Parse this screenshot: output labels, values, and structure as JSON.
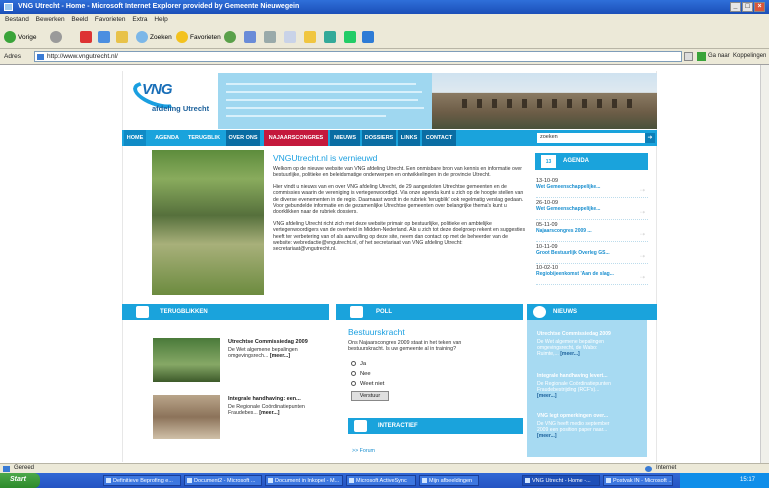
{
  "window": {
    "title": "VNG Utrecht - Home - Microsoft Internet Explorer provided by Gemeente Nieuwegein"
  },
  "menu": [
    "Bestand",
    "Bewerken",
    "Beeld",
    "Favorieten",
    "Extra",
    "Help"
  ],
  "toolbar": {
    "back": "Vorige",
    "search": "Zoeken",
    "favorites": "Favorieten"
  },
  "address": {
    "label": "Adres",
    "url": "http://www.vngutrecht.nl/",
    "go": "Ga naar",
    "links": "Koppelingen"
  },
  "site": {
    "logo_main": "VNG",
    "logo_sub": "afdeling Utrecht",
    "nav": [
      "HOME",
      "AGENDA",
      "TERUGBLIK",
      "OVER ONS",
      "NAJAARSCONGRES",
      "NIEUWS",
      "DOSSIERS",
      "LINKS",
      "CONTACT"
    ],
    "search_placeholder": "zoeken",
    "article": {
      "title": "VNGUtrecht.nl is vernieuwd",
      "p1": "Welkom op de nieuwe website van VNG afdeling Utrecht. Een onmisbare bron van kennis en informatie over bestuurlijke, politieke en beleidsmatige onderwerpen en ontwikkelingen in de provincie Utrecht.",
      "p2": "Hier vindt u nieuws van en over VNG afdeling Utrecht, de 29 aangesloten Utrechtse gemeenten en de commissies waarin de vereniging is vertegenwoordigd. Via onze agenda kunt u zich op de hoogte stellen van de diverse evenementen in de regio. Daarnaast wordt in de rubriek 'terugblik' ook regelmatig verslag gedaan. Voor gebundelde informatie en de gezamenlijke Utrechtse gemeenten over belangrijke thema's kunt u doorklikken naar de rubriek dossiers.",
      "p3": "VNG afdeling Utrecht richt zich met deze website primair op bestuurlijke, politieke en ambtelijke vertegenwoordigers van de overheid in Midden-Nederland. Als u zich tot deze doelgroep rekent en suggesties heeft ter verbetering van of als aanvulling op deze site, neem dan contact op met de beheerder van de website: webredactie@vngutrecht.nl, of het secretariaat van VNG afdeling Utrecht: secretariaat@vngutrecht.nl."
    },
    "agenda": {
      "heading": "AGENDA",
      "cal_label": "13",
      "items": [
        {
          "date": "13-10-09",
          "title": "Wet Gemeenschappelijke..."
        },
        {
          "date": "26-10-09",
          "title": "Wet Gemeenschappelijke..."
        },
        {
          "date": "05-11-09",
          "title": "Najaarscongres 2009 ..."
        },
        {
          "date": "10-11-09",
          "title": "Groot Bestuurlijk Overleg GS..."
        },
        {
          "date": "10-02-10",
          "title": "Regiobijeenkomst 'Aan de slag..."
        }
      ]
    },
    "terugblik": {
      "heading": "TERUGBLIKKEN",
      "items": [
        {
          "title": "Utrechtse Commissiedag 2009",
          "text": "De Wet algemene bepalingen omgevingsrech...",
          "more": "[meer...]"
        },
        {
          "title": "Integrale handhaving: een...",
          "text": "De Regionale Coördinatiepunten Fraudebes...",
          "more": "[meer...]"
        }
      ]
    },
    "poll": {
      "heading": "POLL",
      "title": "Bestuurskracht",
      "question": "Ons Najaarscongres 2009 staat in het teken van bestuurskracht. Is uw gemeente al in training?",
      "options": [
        "Ja",
        "Nee",
        "Weet niet"
      ],
      "button": "Verstuur"
    },
    "interactief": {
      "heading": "INTERACTIEF",
      "forum": ">> Forum"
    },
    "nieuws": {
      "heading": "NIEUWS",
      "items": [
        {
          "title": "Utrechtse Commissiedag 2009",
          "text": "De Wet algemene bepalingen omgevingsrecht, de Wabo: Ruimte,...",
          "more": "[meer...]"
        },
        {
          "title": "Integrale handhaving levert...",
          "text": "De Regionale Coördinatiepunten Fraudebestrijding (RCF's)...",
          "more": "[meer...]"
        },
        {
          "title": "VNG legt opmerkingen over...",
          "text": "De VNG heeft medio september 2009 een position paper naar...",
          "more": "[meer...]"
        }
      ]
    }
  },
  "status": {
    "left": "Gereed",
    "zone": "Internet"
  },
  "taskbar": {
    "start": "Start",
    "tasks": [
      "Definitieve Beprofing e...",
      "Document2 - Microsoft ...",
      "Document in Inkopel - M...",
      "Microsoft ActiveSync",
      "Mijn afbeeldingen",
      "VNG Utrecht - Home -...",
      "Postvak IN - Microsoft ..."
    ],
    "clock": "15:17"
  }
}
